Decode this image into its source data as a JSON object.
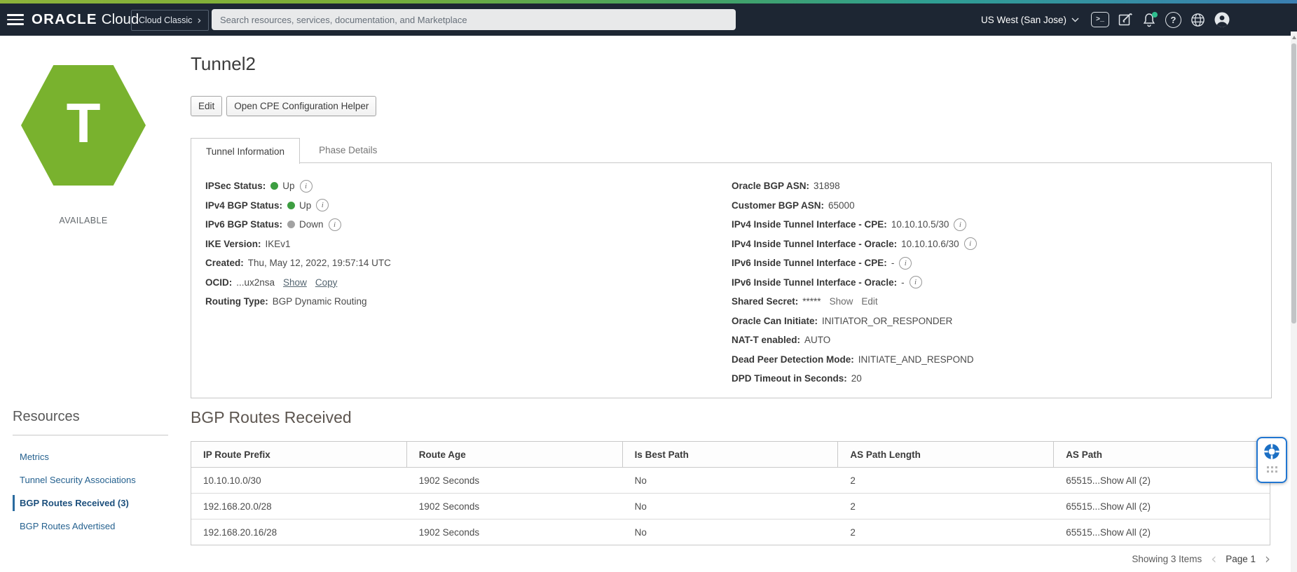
{
  "colors": {
    "header_bg": "#1d2633",
    "brand_strip_left": "#8db33a",
    "brand_strip_right": "#3b7fb2",
    "hexagon_green": "#79b22e",
    "status_up": "#3d9e41",
    "status_down": "#a2a2a2",
    "sidebar_link_blue": "#25618f",
    "widget_border_blue": "#2176d1"
  },
  "header": {
    "logo_primary": "ORACLE",
    "logo_secondary": "Cloud",
    "cloud_classic": "Cloud Classic",
    "search_placeholder": "Search resources, services, documentation, and Marketplace",
    "region": "US West (San Jose)"
  },
  "icons": {
    "terminal_glyph": ">_",
    "help_glyph": "?",
    "info_glyph": "i",
    "cloud_classic_chevron": "›",
    "prev_chevron": "‹",
    "next_chevron": "›"
  },
  "resource": {
    "initial": "T",
    "status": "AVAILABLE",
    "title": "Tunnel2"
  },
  "buttons": {
    "edit": "Edit",
    "open_cpe_helper": "Open CPE Configuration Helper"
  },
  "tabs": {
    "tunnel_information": "Tunnel Information",
    "phase_details": "Phase Details"
  },
  "tunnel_info": {
    "ipsec_status": {
      "label": "IPSec Status:",
      "value": "Up"
    },
    "ipv4_bgp_status": {
      "label": "IPv4 BGP Status:",
      "value": "Up"
    },
    "ipv6_bgp_status": {
      "label": "IPv6 BGP Status:",
      "value": "Down"
    },
    "ike_version": {
      "label": "IKE Version:",
      "value": "IKEv1"
    },
    "created": {
      "label": "Created:",
      "value": "Thu, May 12, 2022, 19:57:14 UTC"
    },
    "ocid": {
      "label": "OCID:",
      "value": "...ux2nsa",
      "show": "Show",
      "copy": "Copy"
    },
    "routing_type": {
      "label": "Routing Type:",
      "value": "BGP Dynamic Routing"
    },
    "oracle_bgp_asn": {
      "label": "Oracle BGP ASN:",
      "value": "31898"
    },
    "customer_bgp_asn": {
      "label": "Customer BGP ASN:",
      "value": "65000"
    },
    "ipv4_cpe": {
      "label": "IPv4 Inside Tunnel Interface - CPE:",
      "value": "10.10.10.5/30"
    },
    "ipv4_oracle": {
      "label": "IPv4 Inside Tunnel Interface - Oracle:",
      "value": "10.10.10.6/30"
    },
    "ipv6_cpe": {
      "label": "IPv6 Inside Tunnel Interface - CPE:",
      "value": "-"
    },
    "ipv6_oracle": {
      "label": "IPv6 Inside Tunnel Interface - Oracle:",
      "value": "-"
    },
    "shared_secret": {
      "label": "Shared Secret:",
      "value": "*****",
      "show": "Show",
      "edit": "Edit"
    },
    "oracle_can_initiate": {
      "label": "Oracle Can Initiate:",
      "value": "INITIATOR_OR_RESPONDER"
    },
    "nat_t": {
      "label": "NAT-T enabled:",
      "value": "AUTO"
    },
    "dpd_mode": {
      "label": "Dead Peer Detection Mode:",
      "value": "INITIATE_AND_RESPOND"
    },
    "dpd_timeout": {
      "label": "DPD Timeout in Seconds:",
      "value": "20"
    }
  },
  "sidebar": {
    "heading": "Resources",
    "items": [
      {
        "label": "Metrics"
      },
      {
        "label": "Tunnel Security Associations"
      },
      {
        "label": "BGP Routes Received (3)"
      },
      {
        "label": "BGP Routes Advertised"
      }
    ]
  },
  "bgp_routes": {
    "heading": "BGP Routes Received",
    "columns": [
      "IP Route Prefix",
      "Route Age",
      "Is Best Path",
      "AS Path Length",
      "AS Path"
    ],
    "rows": [
      {
        "prefix": "10.10.10.0/30",
        "age": "1902 Seconds",
        "best": "No",
        "len": "2",
        "as_path": "65515...",
        "show_all": "Show All (2)"
      },
      {
        "prefix": "192.168.20.0/28",
        "age": "1902 Seconds",
        "best": "No",
        "len": "2",
        "as_path": "65515...",
        "show_all": "Show All (2)"
      },
      {
        "prefix": "192.168.20.16/28",
        "age": "1902 Seconds",
        "best": "No",
        "len": "2",
        "as_path": "65515...",
        "show_all": "Show All (2)"
      }
    ],
    "footer": {
      "showing": "Showing 3 Items",
      "page": "Page 1"
    }
  }
}
